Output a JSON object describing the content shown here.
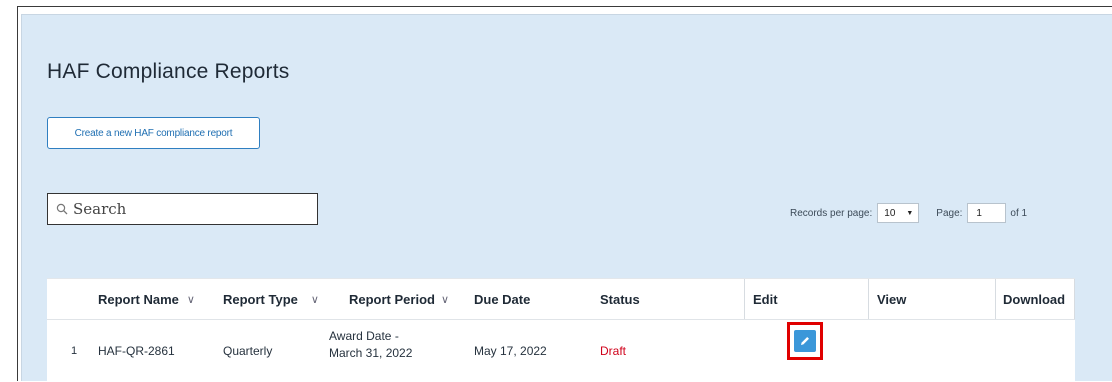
{
  "page": {
    "title": "HAF Compliance Reports",
    "create_button_label": "Create a new HAF compliance report"
  },
  "search": {
    "placeholder": "Search",
    "icon": "search-icon"
  },
  "pagination": {
    "records_per_page_label": "Records per page:",
    "records_per_page_value": "10",
    "page_label": "Page:",
    "current_page": "1",
    "of_total": "of 1"
  },
  "table": {
    "columns": [
      {
        "label": "Report Name",
        "sortable": true
      },
      {
        "label": "Report Type",
        "sortable": true
      },
      {
        "label": "Report Period",
        "sortable": true
      },
      {
        "label": "Due Date",
        "sortable": false
      },
      {
        "label": "Status",
        "sortable": false
      },
      {
        "label": "Edit",
        "sortable": false
      },
      {
        "label": "View",
        "sortable": false
      },
      {
        "label": "Download",
        "sortable": false
      }
    ],
    "rows": [
      {
        "index": "1",
        "report_name": "HAF-QR-2861",
        "report_type": "Quarterly",
        "report_period_line1": "Award Date -",
        "report_period_line2": "March 31, 2022",
        "due_date": "May 17, 2022",
        "status": "Draft",
        "edit_icon": "pencil-icon"
      }
    ]
  },
  "colors": {
    "panel_background": "#dae9f6",
    "accent_blue": "#2f7fc1",
    "status_draft": "#d0021b",
    "highlight_red": "#e00000"
  }
}
